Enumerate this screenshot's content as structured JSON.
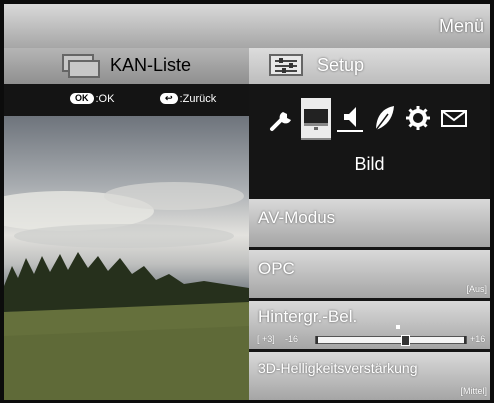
{
  "header": {
    "title": "Menü"
  },
  "tabs": {
    "channel_list": {
      "label": "KAN-Liste",
      "icon": "channel-list-icon"
    },
    "setup": {
      "label": "Setup",
      "icon": "setup-sliders-icon"
    }
  },
  "hints": {
    "ok": {
      "key": "OK",
      "text": ":OK"
    },
    "back": {
      "key": "↩",
      "text": ":Zurück"
    }
  },
  "categories": {
    "items": [
      {
        "name": "wrench-icon"
      },
      {
        "name": "picture-icon"
      },
      {
        "name": "speaker-icon"
      },
      {
        "name": "leaf-icon"
      },
      {
        "name": "gear-icon"
      },
      {
        "name": "envelope-icon"
      }
    ],
    "selected_index": 1,
    "selected_label": "Bild"
  },
  "menu_items": {
    "av_mode": {
      "label": "AV-Modus"
    },
    "opc": {
      "label": "OPC",
      "value": "[Aus]"
    },
    "backlight": {
      "label": "Hintergr.-Bel.",
      "value": "[ +3]",
      "min": "-16",
      "max": "+16",
      "level": 3,
      "range": [
        -16,
        16
      ]
    },
    "brightness3d": {
      "label": "3D-Helligkeitsverstärkung",
      "value": "[Mittel]"
    }
  },
  "colors": {
    "panel_light": "#d9d9d9",
    "panel_dark": "#a5a5a5",
    "background": "#0c0c0c"
  }
}
